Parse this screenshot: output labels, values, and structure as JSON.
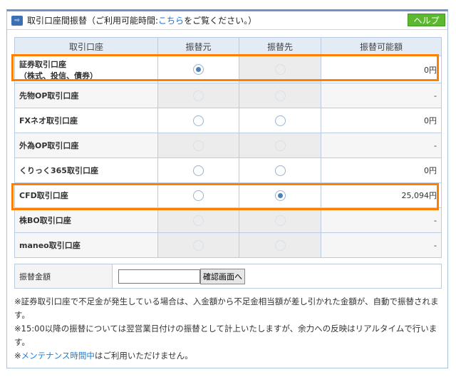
{
  "header": {
    "title_prefix": "取引口座間振替（ご利用可能時間:",
    "link": "こちら",
    "title_suffix": "をご覧ください。）",
    "help": "ヘルプ"
  },
  "columns": [
    "取引口座",
    "振替元",
    "振替先",
    "振替可能額"
  ],
  "rows": [
    {
      "name": "証券取引口座",
      "sub": "（株式、投信、債券）",
      "amount": "0円",
      "from": "checked",
      "to": "disabled"
    },
    {
      "name": "先物OP取引口座",
      "amount": "-",
      "from": "disabled",
      "to": "disabled"
    },
    {
      "name": "FXネオ取引口座",
      "amount": "0円",
      "from": "empty",
      "to": "empty"
    },
    {
      "name": "外為OP取引口座",
      "amount": "-",
      "from": "disabled",
      "to": "disabled"
    },
    {
      "name": "くりっく365取引口座",
      "amount": "0円",
      "from": "empty",
      "to": "empty"
    },
    {
      "name": "CFD取引口座",
      "amount": "25,094円",
      "from": "empty",
      "to": "checked"
    },
    {
      "name": "株BO取引口座",
      "amount": "-",
      "from": "disabled",
      "to": "disabled"
    },
    {
      "name": "maneo取引口座",
      "amount": "-",
      "from": "disabled",
      "to": "disabled"
    }
  ],
  "amount": {
    "label": "振替金額",
    "value": "",
    "button": "確認画面へ"
  },
  "notes": {
    "n1": "※証券取引口座で不足金が発生している場合は、入金額から不足金相当額が差し引かれた金額が、自動で振替されます。",
    "n2": "※15:00以降の振替については翌営業日付けの振替として計上いたしますが、余力への反映はリアルタイムで行います。",
    "n3_prefix": "※",
    "n3_link": "メンテナンス時間中",
    "n3_suffix": "はご利用いただけません。"
  }
}
